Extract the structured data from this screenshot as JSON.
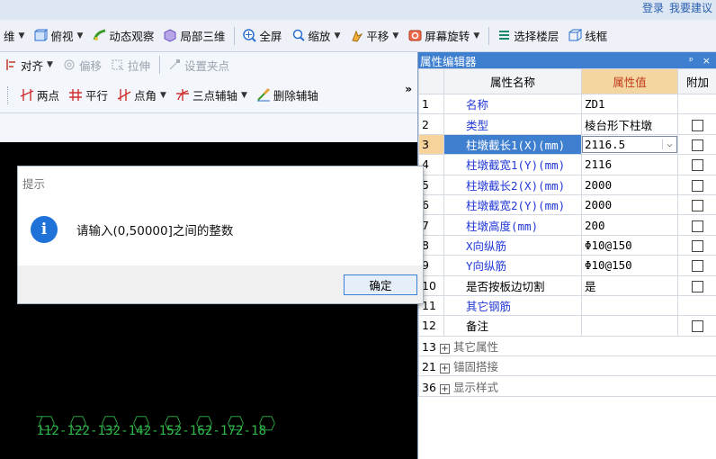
{
  "topbar": {
    "login_label": "登录",
    "feedback_label": "我要建议"
  },
  "toolbar1": [
    {
      "label": "维",
      "icon": "view-cube-icon",
      "dropdown": true
    },
    {
      "label": "俯视",
      "icon": "top-view-icon",
      "dropdown": true
    },
    {
      "label": "动态观察",
      "icon": "orbit-icon",
      "dropdown": false
    },
    {
      "label": "局部三维",
      "icon": "local-3d-icon",
      "dropdown": false
    },
    {
      "label": "全屏",
      "icon": "fullscreen-icon",
      "dropdown": false
    },
    {
      "label": "缩放",
      "icon": "zoom-icon",
      "dropdown": true
    },
    {
      "label": "平移",
      "icon": "pan-icon",
      "dropdown": true
    },
    {
      "label": "屏幕旋转",
      "icon": "screen-rotate-icon",
      "dropdown": true
    },
    {
      "label": "选择楼层",
      "icon": "floor-select-icon",
      "dropdown": false
    },
    {
      "label": "线框",
      "icon": "wireframe-icon",
      "dropdown": false
    }
  ],
  "toolbar2": {
    "align_label": "对齐",
    "offset_label": "偏移",
    "stretch_label": "拉伸",
    "setpoint_label": "设置夹点"
  },
  "toolbar3": {
    "twopoint_label": "两点",
    "parallel_label": "平行",
    "pointangle_label": "点角",
    "threepoint_label": "三点辅轴",
    "delete_label": "删除辅轴",
    "overflow": "»"
  },
  "canvas": {
    "axis_text": "112-122-132-142-152-162-172-18"
  },
  "panel": {
    "title": "属性编辑器",
    "pin": "ᵖ",
    "close": "×",
    "headers": {
      "name": "属性名称",
      "value": "属性值",
      "extra": "附加"
    },
    "rows": [
      {
        "num": "1",
        "name": "名称",
        "value": "ZD1",
        "check": false,
        "style": "blue"
      },
      {
        "num": "2",
        "name": "类型",
        "value": "棱台形下柱墩",
        "check": true,
        "style": "blue"
      },
      {
        "num": "3",
        "name": "柱墩截长1(X)(mm)",
        "value": "2116.5",
        "check": true,
        "style": "blue",
        "selected": true
      },
      {
        "num": "4",
        "name": "柱墩截宽1(Y)(mm)",
        "value": "2116",
        "check": true,
        "style": "blue"
      },
      {
        "num": "5",
        "name": "柱墩截长2(X)(mm)",
        "value": "2000",
        "check": true,
        "style": "blue"
      },
      {
        "num": "6",
        "name": "柱墩截宽2(Y)(mm)",
        "value": "2000",
        "check": true,
        "style": "blue"
      },
      {
        "num": "7",
        "name": "柱墩高度(mm)",
        "value": "200",
        "check": true,
        "style": "blue"
      },
      {
        "num": "8",
        "name": "X向纵筋",
        "value": "Φ10@150",
        "check": true,
        "style": "blue"
      },
      {
        "num": "9",
        "name": "Y向纵筋",
        "value": "Φ10@150",
        "check": true,
        "style": "blue"
      },
      {
        "num": "10",
        "name": "是否按板边切割",
        "value": "是",
        "check": true,
        "style": "black"
      },
      {
        "num": "11",
        "name": "其它钢筋",
        "value": "",
        "check": false,
        "style": "blue"
      },
      {
        "num": "12",
        "name": "备注",
        "value": "",
        "check": true,
        "style": "black"
      }
    ],
    "groups": [
      {
        "num": "13",
        "name": "其它属性"
      },
      {
        "num": "21",
        "name": "锚固搭接"
      },
      {
        "num": "36",
        "name": "显示样式"
      }
    ]
  },
  "dialog": {
    "title": "提示",
    "message": "请输入(0,50000]之间的整数",
    "ok_label": "确定"
  }
}
